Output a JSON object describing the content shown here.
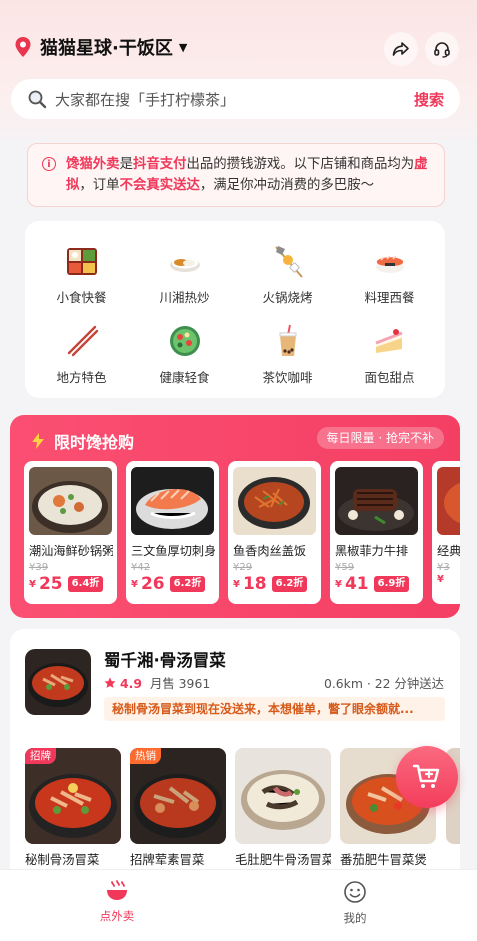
{
  "header": {
    "location": "猫猫星球·干饭区",
    "location_caret": "▼",
    "share_icon": "share-icon",
    "service_icon": "headset-icon"
  },
  "search": {
    "placeholder": "大家都在搜「手打柠檬茶」",
    "button": "搜索"
  },
  "notice": {
    "brand": "馋猫外卖",
    "t1": "是",
    "pay": "抖音支付",
    "t2": "出品的攒钱游戏。以下店铺和商品均为",
    "virtual": "虚拟",
    "t3": "，订单",
    "no_delivery": "不会真实送达",
    "t4": "，满足你冲动消费的多巴胺～"
  },
  "categories": [
    {
      "label": "小食快餐",
      "icon": "bento-icon"
    },
    {
      "label": "川湘热炒",
      "icon": "curry-icon"
    },
    {
      "label": "火锅烧烤",
      "icon": "oden-skewer-icon"
    },
    {
      "label": "料理西餐",
      "icon": "sushi-icon"
    },
    {
      "label": "地方特色",
      "icon": "chopsticks-icon"
    },
    {
      "label": "健康轻食",
      "icon": "salad-icon"
    },
    {
      "label": "茶饮咖啡",
      "icon": "bubble-tea-icon"
    },
    {
      "label": "面包甜点",
      "icon": "cake-icon"
    }
  ],
  "flash": {
    "title": "限时馋抢购",
    "badge": "每日限量 · 抢完不补",
    "items": [
      {
        "name": "潮汕海鲜砂锅粥",
        "orig": "¥39",
        "yen": "¥",
        "price": "25",
        "discount": "6.4折"
      },
      {
        "name": "三文鱼厚切刺身",
        "orig": "¥42",
        "yen": "¥",
        "price": "26",
        "discount": "6.2折"
      },
      {
        "name": "鱼香肉丝盖饭",
        "orig": "¥29",
        "yen": "¥",
        "price": "18",
        "discount": "6.2折"
      },
      {
        "name": "黑椒菲力牛排",
        "orig": "¥59",
        "yen": "¥",
        "price": "41",
        "discount": "6.9折"
      },
      {
        "name": "经典",
        "orig": "¥3",
        "yen": "¥",
        "price": "",
        "discount": ""
      }
    ]
  },
  "shop": {
    "name": "蜀千湘·骨汤冒菜",
    "rating": "4.9",
    "sales": "月售 3961",
    "distance": "0.6km · 22 分钟送达",
    "tip": "秘制骨汤冒菜到现在没送来，本想催单，瞥了眼余额就...",
    "dishes": [
      {
        "name": "秘制骨汤冒菜",
        "tag": "招牌"
      },
      {
        "name": "招牌荤素冒菜",
        "tag": "热销"
      },
      {
        "name": "毛肚肥牛骨汤冒菜",
        "tag": ""
      },
      {
        "name": "番茄肥牛冒菜煲",
        "tag": ""
      }
    ]
  },
  "tabs": [
    {
      "label": "点外卖",
      "active": true
    },
    {
      "label": "我的",
      "active": false
    }
  ],
  "colors": {
    "accent": "#f0385a",
    "flash_bg": "#f43f63"
  }
}
